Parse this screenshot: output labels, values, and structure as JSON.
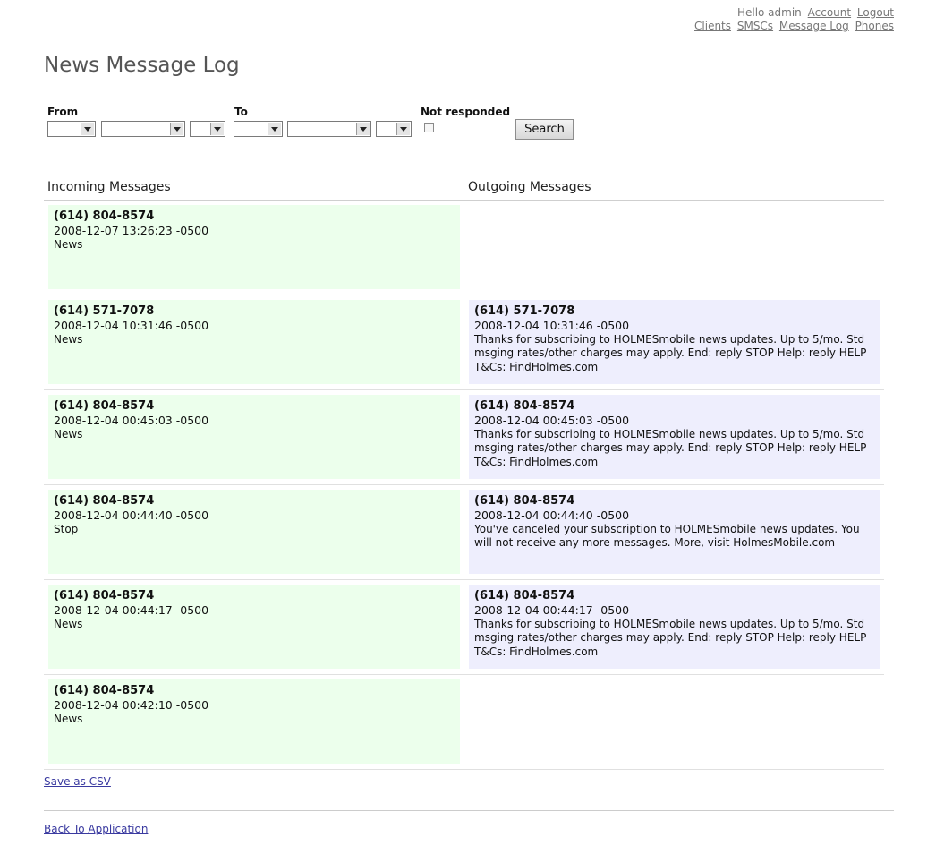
{
  "nav": {
    "greeting": "Hello admin",
    "account": "Account",
    "logout": "Logout",
    "clients": "Clients",
    "smscs": "SMSCs",
    "message_log": "Message Log",
    "phones": "Phones"
  },
  "page_title": "News Message Log",
  "filter": {
    "from_label": "From",
    "to_label": "To",
    "not_responded_label": "Not responded",
    "not_responded_checked": false,
    "search_button": "Search"
  },
  "table": {
    "incoming_header": "Incoming Messages",
    "outgoing_header": "Outgoing Messages",
    "rows": [
      {
        "incoming": {
          "phone": "(614) 804-8574",
          "time": "2008-12-07 13:26:23 -0500",
          "text": "News"
        },
        "outgoing": null
      },
      {
        "incoming": {
          "phone": "(614) 571-7078",
          "time": "2008-12-04 10:31:46 -0500",
          "text": "News"
        },
        "outgoing": {
          "phone": "(614) 571-7078",
          "time": "2008-12-04 10:31:46 -0500",
          "text": "Thanks for subscribing to HOLMESmobile news updates. Up to 5/mo. Std msging rates/other charges may apply. End: reply STOP Help: reply HELP T&Cs: FindHolmes.com"
        }
      },
      {
        "incoming": {
          "phone": "(614) 804-8574",
          "time": "2008-12-04 00:45:03 -0500",
          "text": "News"
        },
        "outgoing": {
          "phone": "(614) 804-8574",
          "time": "2008-12-04 00:45:03 -0500",
          "text": "Thanks for subscribing to HOLMESmobile news updates. Up to 5/mo. Std msging rates/other charges may apply. End: reply STOP Help: reply HELP T&Cs: FindHolmes.com"
        }
      },
      {
        "incoming": {
          "phone": "(614) 804-8574",
          "time": "2008-12-04 00:44:40 -0500",
          "text": "Stop"
        },
        "outgoing": {
          "phone": "(614) 804-8574",
          "time": "2008-12-04 00:44:40 -0500",
          "text": "You've canceled your subscription to HOLMESmobile news updates. You will not receive any more messages. More, visit HolmesMobile.com"
        }
      },
      {
        "incoming": {
          "phone": "(614) 804-8574",
          "time": "2008-12-04 00:44:17 -0500",
          "text": "News"
        },
        "outgoing": {
          "phone": "(614) 804-8574",
          "time": "2008-12-04 00:44:17 -0500",
          "text": "Thanks for subscribing to HOLMESmobile news updates. Up to 5/mo. Std msging rates/other charges may apply. End: reply STOP Help: reply HELP T&Cs: FindHolmes.com"
        }
      },
      {
        "incoming": {
          "phone": "(614) 804-8574",
          "time": "2008-12-04 00:42:10 -0500",
          "text": "News"
        },
        "outgoing": null
      }
    ]
  },
  "links": {
    "save_csv": "Save as CSV",
    "back": "Back To Application"
  },
  "colors": {
    "incoming_bg": "#ecffec",
    "outgoing_bg": "#eeeefd",
    "link": "#3a3aa0"
  }
}
